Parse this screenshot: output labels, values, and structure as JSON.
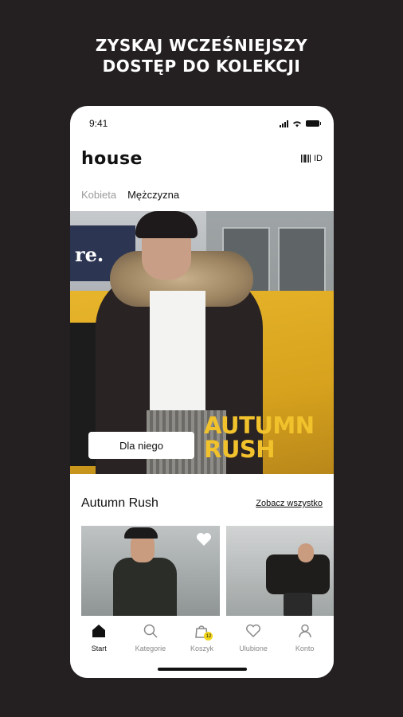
{
  "headline": {
    "line1": "ZYSKAJ WCZEŚNIEJSZY",
    "line2": "DOSTĘP DO KOLEKCJI"
  },
  "status_bar": {
    "time": "9:41",
    "icons": [
      "signal-icon",
      "wifi-icon",
      "battery-icon"
    ]
  },
  "app_header": {
    "logo": "HOUSE",
    "id_label": "ID"
  },
  "tabs": [
    {
      "label": "Kobieta",
      "active": false
    },
    {
      "label": "Mężczyzna",
      "active": true
    }
  ],
  "hero": {
    "banner_text": "re.",
    "title_line1": "AUTUMN",
    "title_line2": "RUSH",
    "button_label": "Dla niego"
  },
  "section": {
    "title": "Autumn Rush",
    "see_all": "Zobacz wszystko"
  },
  "bottom_nav": [
    {
      "label": "Start",
      "icon": "home-icon",
      "active": true
    },
    {
      "label": "Kategorie",
      "icon": "search-icon",
      "active": false
    },
    {
      "label": "Koszyk",
      "icon": "bag-icon",
      "active": false,
      "badge": "12"
    },
    {
      "label": "Ulubione",
      "icon": "heart-icon",
      "active": false
    },
    {
      "label": "Konto",
      "icon": "user-icon",
      "active": false
    }
  ],
  "colors": {
    "background": "#242021",
    "accent_yellow": "#f2c22c",
    "badge_yellow": "#f2d61c"
  }
}
